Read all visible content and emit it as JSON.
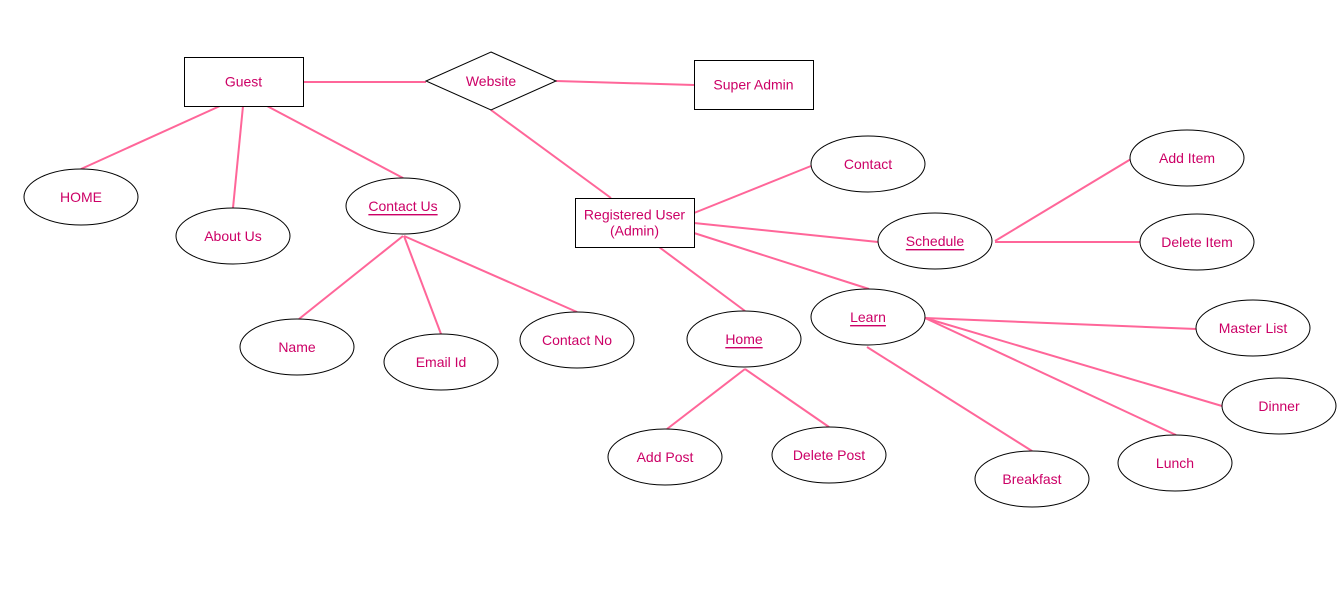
{
  "diagram": {
    "type": "er-diagram",
    "colors": {
      "text": "#cc0066",
      "edge": "#ff6699",
      "outline": "#000000",
      "background": "#ffffff"
    },
    "nodes": [
      {
        "id": "guest",
        "label": "Guest",
        "kind": "entity"
      },
      {
        "id": "website",
        "label": "Website",
        "kind": "relationship"
      },
      {
        "id": "super-admin",
        "label": "Super Admin",
        "kind": "entity"
      },
      {
        "id": "registered-user",
        "label": "Registered User\n(Admin)",
        "lines": [
          "Registered User",
          "(Admin)"
        ],
        "kind": "entity"
      },
      {
        "id": "home-guest",
        "label": "HOME",
        "kind": "attribute"
      },
      {
        "id": "about-us",
        "label": "About Us",
        "kind": "attribute"
      },
      {
        "id": "contact-us",
        "label": "Contact Us",
        "kind": "attribute",
        "underlined": true
      },
      {
        "id": "name",
        "label": "Name",
        "kind": "attribute"
      },
      {
        "id": "email-id",
        "label": "Email Id",
        "kind": "attribute"
      },
      {
        "id": "contact-no",
        "label": "Contact No",
        "kind": "attribute"
      },
      {
        "id": "contact",
        "label": "Contact",
        "kind": "attribute"
      },
      {
        "id": "schedule",
        "label": "Schedule",
        "kind": "attribute",
        "underlined": true
      },
      {
        "id": "add-item",
        "label": "Add Item",
        "kind": "attribute"
      },
      {
        "id": "delete-item",
        "label": "Delete Item",
        "kind": "attribute"
      },
      {
        "id": "home-admin",
        "label": "Home",
        "kind": "attribute",
        "underlined": true
      },
      {
        "id": "add-post",
        "label": "Add Post",
        "kind": "attribute"
      },
      {
        "id": "delete-post",
        "label": "Delete Post",
        "kind": "attribute"
      },
      {
        "id": "learn",
        "label": "Learn",
        "kind": "attribute",
        "underlined": true
      },
      {
        "id": "master-list",
        "label": "Master List",
        "kind": "attribute"
      },
      {
        "id": "dinner",
        "label": "Dinner",
        "kind": "attribute"
      },
      {
        "id": "lunch",
        "label": "Lunch",
        "kind": "attribute"
      },
      {
        "id": "breakfast",
        "label": "Breakfast",
        "kind": "attribute"
      }
    ],
    "edges": [
      [
        "guest",
        "website"
      ],
      [
        "website",
        "super-admin"
      ],
      [
        "website",
        "registered-user"
      ],
      [
        "guest",
        "home-guest"
      ],
      [
        "guest",
        "about-us"
      ],
      [
        "guest",
        "contact-us"
      ],
      [
        "contact-us",
        "name"
      ],
      [
        "contact-us",
        "email-id"
      ],
      [
        "contact-us",
        "contact-no"
      ],
      [
        "registered-user",
        "contact"
      ],
      [
        "registered-user",
        "schedule"
      ],
      [
        "registered-user",
        "learn"
      ],
      [
        "registered-user",
        "home-admin"
      ],
      [
        "schedule",
        "add-item"
      ],
      [
        "schedule",
        "delete-item"
      ],
      [
        "home-admin",
        "add-post"
      ],
      [
        "home-admin",
        "delete-post"
      ],
      [
        "learn",
        "master-list"
      ],
      [
        "learn",
        "dinner"
      ],
      [
        "learn",
        "lunch"
      ],
      [
        "learn",
        "breakfast"
      ]
    ]
  }
}
